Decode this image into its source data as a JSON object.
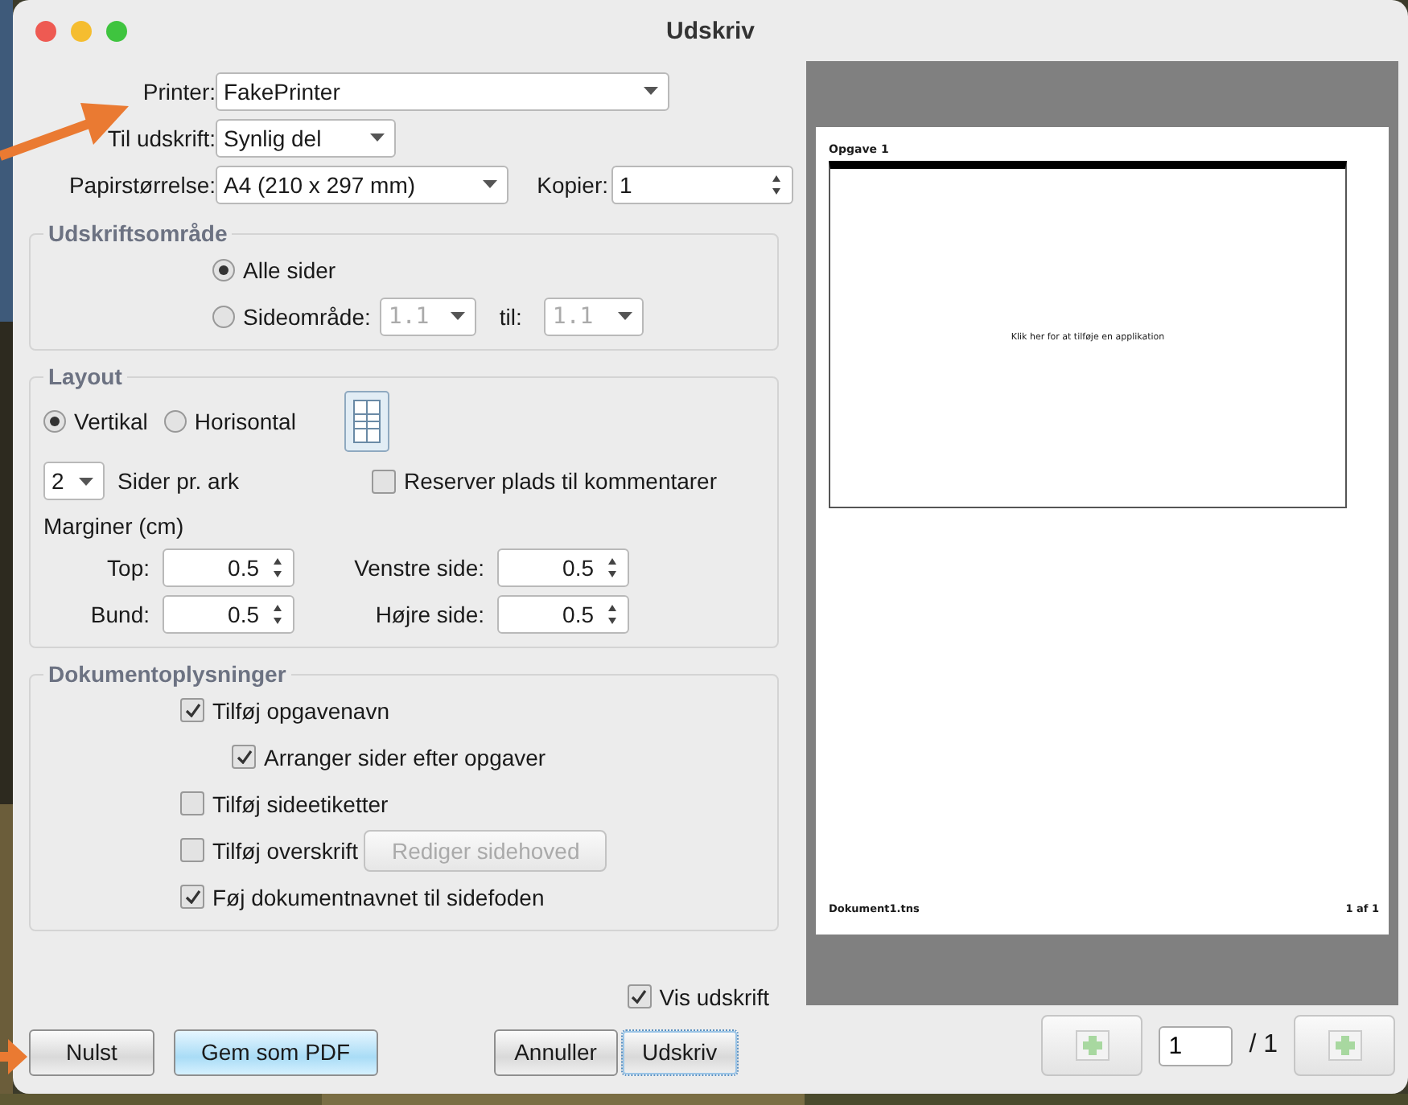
{
  "window": {
    "title": "Udskriv"
  },
  "form": {
    "printer": {
      "label": "Printer:",
      "value": "FakePrinter"
    },
    "output": {
      "label": "Til udskrift:",
      "value": "Synlig del"
    },
    "paper": {
      "label": "Papirstørrelse:",
      "value": "A4 (210 x 297 mm)"
    },
    "copies": {
      "label": "Kopier:",
      "value": "1"
    }
  },
  "print_area": {
    "title": "Udskriftsområde",
    "options": [
      {
        "label": "Alle sider",
        "selected": true
      },
      {
        "label": "Sideområde:",
        "selected": false
      }
    ],
    "range_from": {
      "value": "1.1",
      "disabled": true
    },
    "range_to_label": "til:",
    "range_to": {
      "value": "1.1",
      "disabled": true
    }
  },
  "layout": {
    "title": "Layout",
    "orientations": [
      {
        "label": "Vertikal",
        "selected": true
      },
      {
        "label": "Horisontal",
        "selected": false
      }
    ],
    "pages_per_sheet": {
      "value": "2",
      "label": "Sider pr. ark"
    },
    "reserve_comments": {
      "label": "Reserver plads til kommentarer",
      "checked": false
    },
    "margins_title": "Marginer (cm)",
    "margins": [
      {
        "label": "Top:",
        "value": "0.5"
      },
      {
        "label": "Venstre side:",
        "value": "0.5"
      },
      {
        "label": "Bund:",
        "value": "0.5"
      },
      {
        "label": "Højre side:",
        "value": "0.5"
      }
    ]
  },
  "doc_info": {
    "title": "Dokumentoplysninger",
    "options": [
      {
        "label": "Tilføj opgavenavn",
        "checked": true,
        "children": [
          {
            "label": "Arranger sider efter opgaver",
            "checked": true
          }
        ]
      },
      {
        "label": "Tilføj sideetiketter",
        "checked": false
      },
      {
        "label": "Tilføj overskrift",
        "checked": false,
        "button": {
          "label": "Rediger sidehoved",
          "disabled": true
        }
      },
      {
        "label": "Føj dokumentnavnet til sidefoden",
        "checked": true
      }
    ]
  },
  "show_preview": {
    "label": "Vis udskrift",
    "checked": true
  },
  "buttons": [
    {
      "label": "Nulst",
      "kind": "plain"
    },
    {
      "label": "Gem som PDF",
      "kind": "primary"
    },
    {
      "label": "Annuller",
      "kind": "plain"
    },
    {
      "label": "Udskriv",
      "kind": "focused"
    }
  ],
  "preview": {
    "heading": "Opgave 1",
    "placeholder": "Klik her for at tilføje en applikation",
    "footer_left": "Dokument1.tns",
    "footer_right": "1 af 1"
  },
  "pager": {
    "page": "1",
    "total": "/ 1"
  }
}
